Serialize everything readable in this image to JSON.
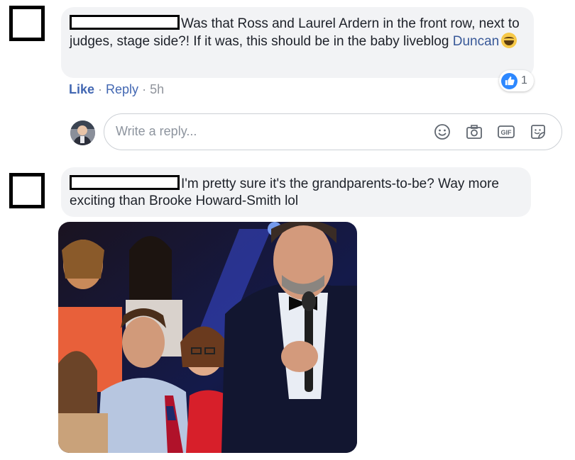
{
  "comment1": {
    "text": "Was that Ross and Laurel Ardern in the front row, next to judges, stage side?! If it was, this should be in the baby liveblog",
    "mention": "Duncan",
    "reaction_count": "1"
  },
  "actions": {
    "like": "Like",
    "sep1": " · ",
    "reply": "Reply",
    "sep2": " · ",
    "time": "5h"
  },
  "reply_box": {
    "placeholder": "Write a reply...",
    "gif_label": "GIF"
  },
  "comment2": {
    "text": "I'm pretty sure it's the grandparents-to-be? Way more exciting than Brooke Howard-Smith lol"
  },
  "icons": {
    "like": "like-thumb-icon",
    "emoji": "emoji-icon",
    "camera": "camera-icon",
    "gif": "gif-icon",
    "sticker": "sticker-icon"
  },
  "colors": {
    "link": "#4267b2",
    "bubble": "#f2f3f5",
    "like_blue": "#2d88ff"
  }
}
